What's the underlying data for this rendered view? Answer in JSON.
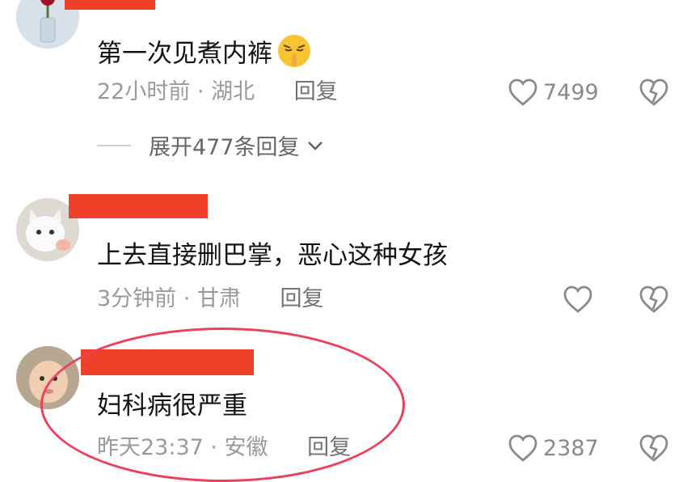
{
  "comments": [
    {
      "text": "第一次见煮内裤",
      "time": "22小时前",
      "location": "湖北",
      "reply_label": "回复",
      "likes": "7499",
      "expand_label": "展开477条回复"
    },
    {
      "text": "上去直接删巴掌，恶心这种女孩",
      "time": "3分钟前",
      "location": "甘肃",
      "reply_label": "回复",
      "likes": ""
    },
    {
      "text": "妇科病很严重",
      "time": "昨天23:37",
      "location": "安徽",
      "reply_label": "回复",
      "likes": "2387"
    }
  ],
  "icons": {
    "like": "heart-outline-icon",
    "dislike": "broken-heart-icon",
    "expand": "chevron-down-icon",
    "emoji": "shush-face-emoji-icon"
  },
  "colors": {
    "redaction": "#f0402a",
    "highlight_circle": "#e8425c",
    "meta_text": "#9a9a9a"
  }
}
